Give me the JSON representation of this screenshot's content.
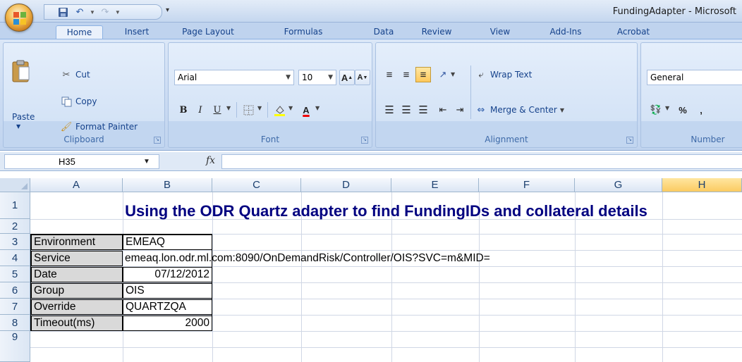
{
  "window": {
    "title": "FundingAdapter - Microsoft"
  },
  "tabs": [
    "Home",
    "Insert",
    "Page Layout",
    "Formulas",
    "Data",
    "Review",
    "View",
    "Add-Ins",
    "Acrobat"
  ],
  "ribbon": {
    "clipboard": {
      "label": "Clipboard",
      "cut": "Cut",
      "copy": "Copy",
      "paste": "Paste",
      "format_painter": "Format Painter"
    },
    "font": {
      "label": "Font",
      "name": "Arial",
      "size": "10"
    },
    "alignment": {
      "label": "Alignment",
      "wrap_text": "Wrap Text",
      "merge_center": "Merge & Center"
    },
    "number": {
      "label": "Number",
      "format": "General",
      "percent": "%",
      "comma": ","
    }
  },
  "formula_bar": {
    "name_box": "H35",
    "fx": "fx",
    "formula": ""
  },
  "grid": {
    "columns": [
      "A",
      "B",
      "C",
      "D",
      "E",
      "F",
      "G",
      "H"
    ],
    "rows": [
      "1",
      "2",
      "3",
      "4",
      "5",
      "6",
      "7",
      "8",
      "9"
    ],
    "title": "Using the ODR Quartz adapter to find FundingIDs and collateral details",
    "params": [
      {
        "label": "Environment",
        "value": "EMEAQ"
      },
      {
        "label": "Service",
        "value": "emeaq.lon.odr.ml.com:8090/OnDemandRisk/Controller/OIS?SVC=m&MID="
      },
      {
        "label": "Date",
        "value": "07/12/2012"
      },
      {
        "label": "Group",
        "value": "OIS"
      },
      {
        "label": "Override",
        "value": "QUARTZQA"
      },
      {
        "label": "Timeout(ms)",
        "value": "2000"
      }
    ]
  },
  "colors": {
    "title_text": "#000080",
    "ribbon_text": "#15428b",
    "selected_header": "#fbcb61"
  }
}
